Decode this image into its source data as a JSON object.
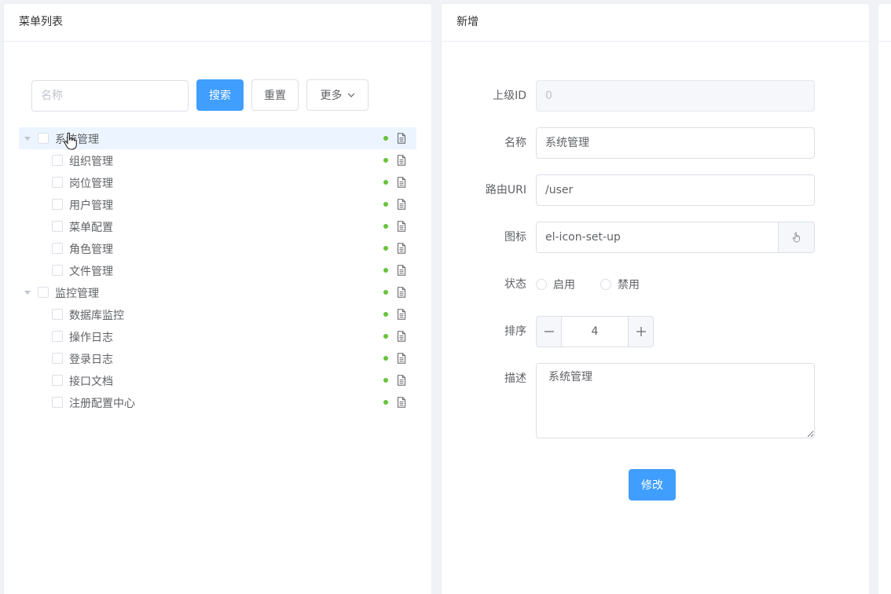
{
  "left_panel": {
    "title": "菜单列表",
    "search": {
      "placeholder": "名称",
      "value": ""
    },
    "buttons": {
      "search": "搜索",
      "reset": "重置",
      "more": "更多"
    },
    "tree": [
      {
        "label": "系统管理",
        "level": 0,
        "expanded": true,
        "status": "enabled"
      },
      {
        "label": "组织管理",
        "level": 1,
        "status": "enabled"
      },
      {
        "label": "岗位管理",
        "level": 1,
        "status": "enabled"
      },
      {
        "label": "用户管理",
        "level": 1,
        "status": "enabled"
      },
      {
        "label": "菜单配置",
        "level": 1,
        "status": "enabled"
      },
      {
        "label": "角色管理",
        "level": 1,
        "status": "enabled"
      },
      {
        "label": "文件管理",
        "level": 1,
        "status": "enabled"
      },
      {
        "label": "监控管理",
        "level": 0,
        "expanded": true,
        "status": "enabled"
      },
      {
        "label": "数据库监控",
        "level": 1,
        "status": "enabled"
      },
      {
        "label": "操作日志",
        "level": 1,
        "status": "enabled"
      },
      {
        "label": "登录日志",
        "level": 1,
        "status": "enabled"
      },
      {
        "label": "接口文档",
        "level": 1,
        "status": "enabled"
      },
      {
        "label": "注册配置中心",
        "level": 1,
        "status": "enabled"
      }
    ]
  },
  "right_panel": {
    "title": "新增",
    "form": {
      "parent_id": {
        "label": "上级ID",
        "value": "0"
      },
      "name": {
        "label": "名称",
        "value": "系统管理"
      },
      "route": {
        "label": "路由URI",
        "value": "/user"
      },
      "icon": {
        "label": "图标",
        "value": "el-icon-set-up"
      },
      "status": {
        "label": "状态",
        "options": [
          "启用",
          "禁用"
        ]
      },
      "sort": {
        "label": "排序",
        "value": "4"
      },
      "desc": {
        "label": "描述",
        "value": "系统管理"
      },
      "submit": "修改"
    }
  },
  "colors": {
    "primary": "#409eff",
    "status_dot": "#67c23a",
    "hover_row": "#ecf5ff"
  }
}
